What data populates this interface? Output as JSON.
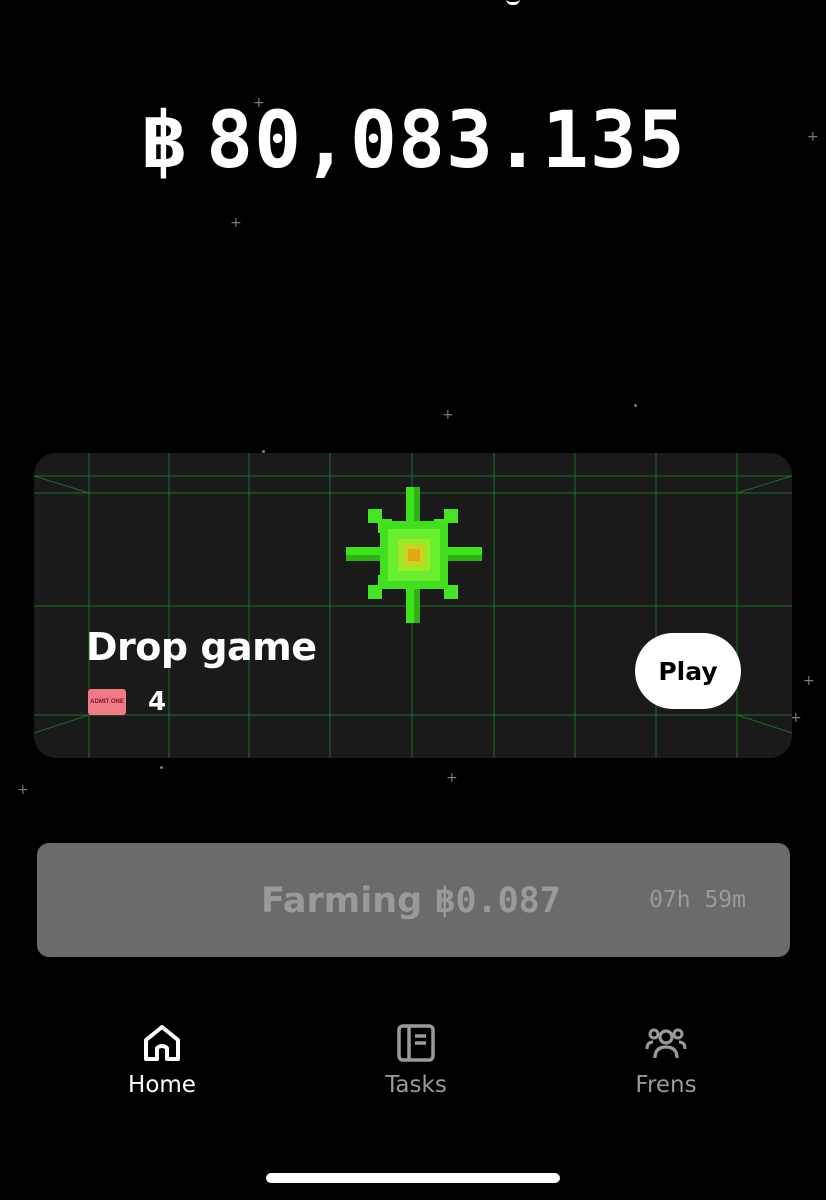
{
  "balance": {
    "symbol": "฿",
    "amount": "80,083.135"
  },
  "card": {
    "title": "Drop game",
    "ticket_icon_text": "ADMIT ONE",
    "ticket_count": "4",
    "play_label": "Play"
  },
  "farming": {
    "label": "Farming",
    "symbol": "฿",
    "amount": "0.087",
    "timer": "07h 59m"
  },
  "nav": {
    "items": [
      {
        "label": "Home",
        "icon": "home-icon",
        "active": true
      },
      {
        "label": "Tasks",
        "icon": "tasks-icon",
        "active": false
      },
      {
        "label": "Frens",
        "icon": "frens-icon",
        "active": false
      }
    ]
  },
  "colors": {
    "background": "#000000",
    "card": "#1a1a1a",
    "grid": "#1f6b2a",
    "flower_green": "#39e01c",
    "ticket": "#f07a86",
    "farming_bg": "#6b6b6b",
    "muted_text": "#9a9a9a"
  }
}
